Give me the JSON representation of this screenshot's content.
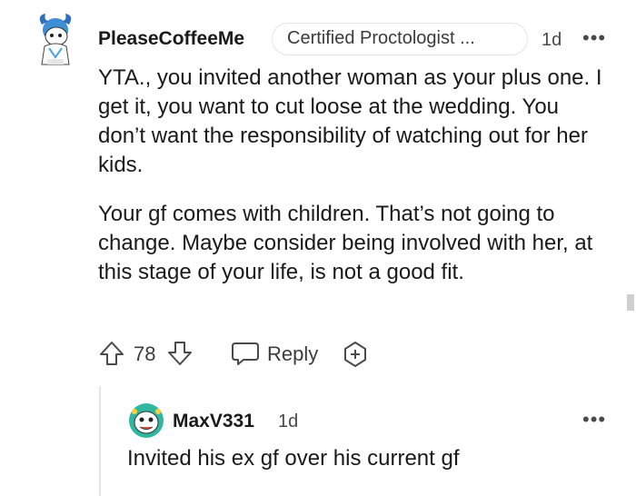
{
  "comment": {
    "username": "PleaseCoffeeMe",
    "flair": "Certified Proctologist ...",
    "time": "1d",
    "more": "•••",
    "body": [
      "YTA., you invited another woman as your plus one. I get it, you want to cut loose at the wedding. You don’t want the responsibility of watching out for her kids.",
      "Your gf comes with children. That’s not going to change. Maybe consider being involved with her, at this stage of your life, is not a good fit."
    ],
    "votes": "78",
    "reply_label": "Reply"
  },
  "reply": {
    "username": "MaxV331",
    "time": "1d",
    "more": "•••",
    "body": "Invited his ex gf over his current gf"
  },
  "colors": {
    "text": "#1a1a1b",
    "muted": "#4a4a4a",
    "avatar_blue": "#4aa3df",
    "avatar_teal": "#2fb7a0"
  }
}
